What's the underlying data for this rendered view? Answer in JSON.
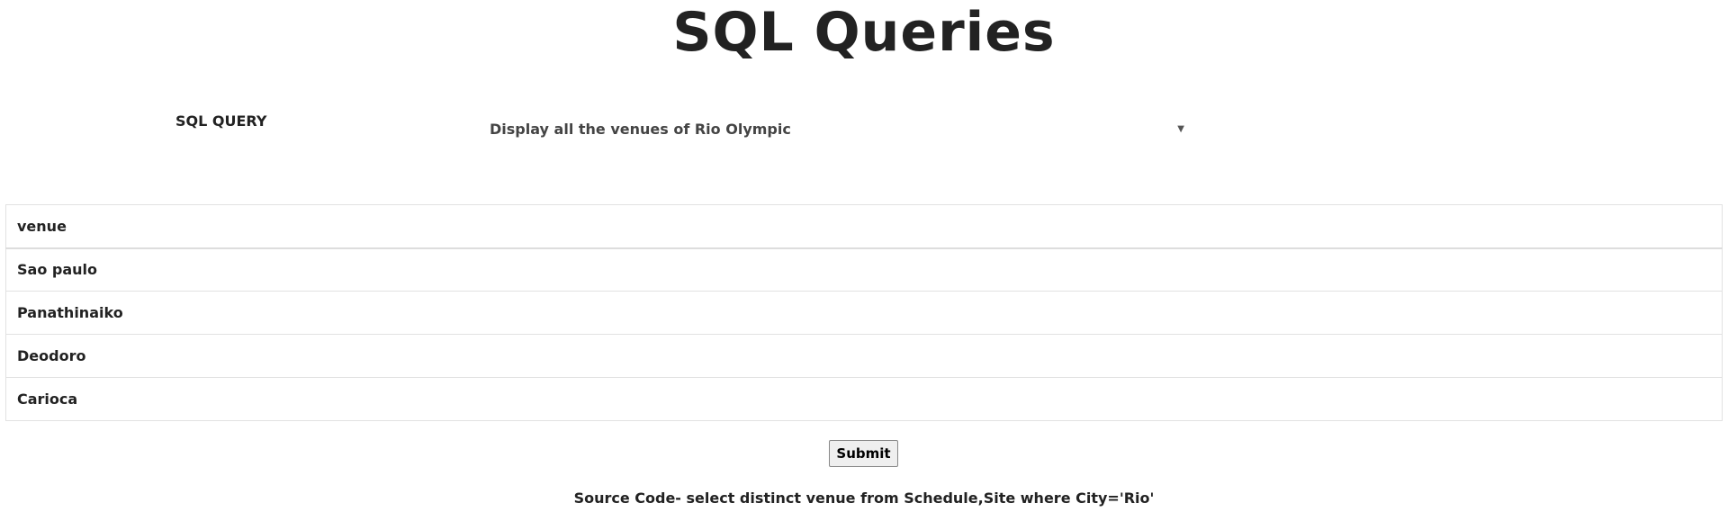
{
  "title": "SQL Queries",
  "query_label": "SQL QUERY",
  "query_select": {
    "selected": "Display all the venues of Rio Olympic",
    "arrow": "▼"
  },
  "table": {
    "header": "venue",
    "rows": [
      "Sao paulo",
      "Panathinaiko",
      "Deodoro",
      "Carioca"
    ]
  },
  "submit_label": "Submit",
  "source_code": "Source Code- select distinct venue from Schedule,Site where City='Rio'"
}
